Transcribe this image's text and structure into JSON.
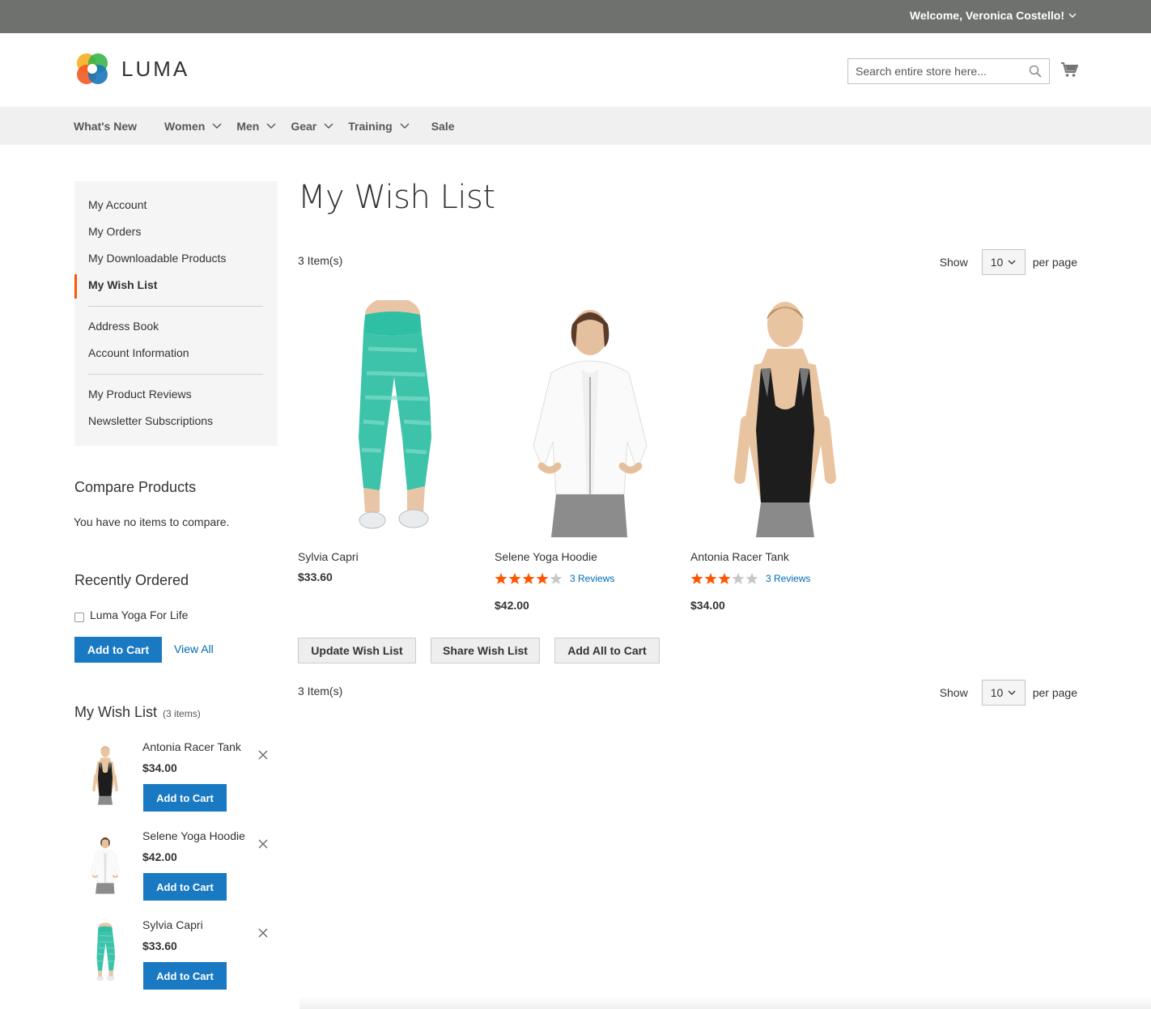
{
  "header": {
    "welcome": "Welcome, Veronica Costello!",
    "logo_text": "LUMA",
    "search_placeholder": "Search entire store here...",
    "icons": [
      "logo-icon",
      "search-icon",
      "cart-icon",
      "chevron-down-icon"
    ]
  },
  "nav": {
    "items": [
      {
        "label": "What's New"
      },
      {
        "label": "Women"
      },
      {
        "label": "Men"
      },
      {
        "label": "Gear"
      },
      {
        "label": "Training"
      },
      {
        "label": "Sale"
      }
    ]
  },
  "account_nav": {
    "items": [
      "My Account",
      "My Orders",
      "My Downloadable Products",
      "My Wish List",
      "Address Book",
      "Account Information",
      "My Product Reviews",
      "Newsletter Subscriptions"
    ],
    "current": "My Wish List"
  },
  "compare": {
    "title": "Compare Products",
    "empty": "You have no items to compare."
  },
  "recent": {
    "title": "Recently Ordered",
    "item": "Luma Yoga For Life",
    "add_to_cart": "Add to Cart",
    "view_all": "View All"
  },
  "sidebar_wishlist": {
    "title": "My Wish List",
    "count": "(3 items)",
    "items": [
      {
        "name": "Antonia Racer Tank",
        "price": "$34.00",
        "button": "Add to Cart"
      },
      {
        "name": "Selene Yoga Hoodie",
        "price": "$42.00",
        "button": "Add to Cart"
      },
      {
        "name": "Sylvia Capri",
        "price": "$33.60",
        "button": "Add to Cart"
      }
    ]
  },
  "main": {
    "title": "My Wish List",
    "item_count": "3 Item(s)",
    "show_label": "Show",
    "per_page_value": "10",
    "per_page_label": "per page",
    "products": [
      {
        "name": "Sylvia Capri",
        "price": "$33.60",
        "rating": null,
        "reviews": ""
      },
      {
        "name": "Selene Yoga Hoodie",
        "price": "$42.00",
        "rating": 4,
        "reviews": "3 Reviews"
      },
      {
        "name": "Antonia Racer Tank",
        "price": "$34.00",
        "rating": 3,
        "reviews": "3 Reviews"
      }
    ],
    "buttons": {
      "update": "Update Wish List",
      "share": "Share Wish List",
      "add_all": "Add All to Cart"
    }
  },
  "colors": {
    "accent": "#1979c3",
    "link": "#006bb4",
    "star": "#ff5501",
    "topbar": "#6e716e"
  }
}
